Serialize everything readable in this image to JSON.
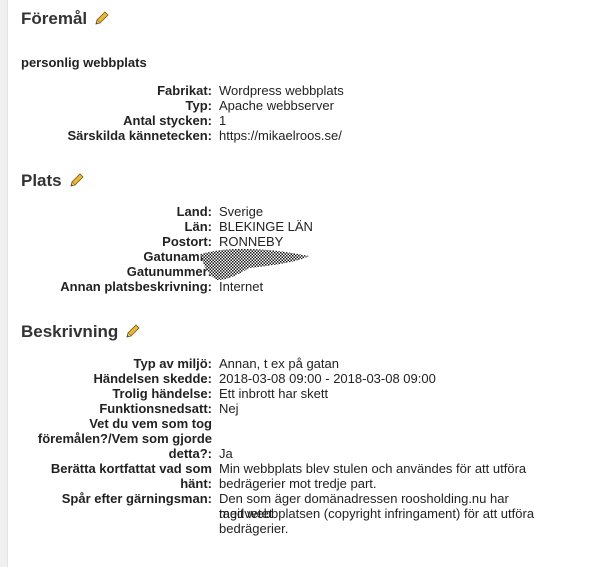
{
  "foremal": {
    "title": "Föremål",
    "edit_icon": "pencil-icon",
    "subtitle": "personlig webbplats",
    "rows": [
      {
        "label": "Fabrikat:",
        "value": "Wordpress webbplats"
      },
      {
        "label": "Typ:",
        "value": "Apache webbserver"
      },
      {
        "label": "Antal stycken:",
        "value": "1"
      },
      {
        "label": "Särskilda kännetecken:",
        "value": "https://mikaelroos.se/"
      }
    ]
  },
  "plats": {
    "title": "Plats",
    "edit_icon": "pencil-icon",
    "rows": [
      {
        "label": "Land:",
        "value": "Sverige"
      },
      {
        "label": "Län:",
        "value": "BLEKINGE LÄN"
      },
      {
        "label": "Postort:",
        "value": "RONNEBY"
      },
      {
        "label": "Gatunamn:",
        "value": ""
      },
      {
        "label": "Gatunummer:",
        "value": ""
      },
      {
        "label": "Annan platsbeskrivning:",
        "value": "Internet"
      }
    ]
  },
  "beskrivning": {
    "title": "Beskrivning",
    "edit_icon": "pencil-icon",
    "rows": [
      {
        "label": "Typ av miljö:",
        "value": "Annan, t ex på gatan"
      },
      {
        "label": "Händelsen skedde:",
        "value": "2018-03-08 09:00 - 2018-03-08 09:00"
      },
      {
        "label": "Trolig händelse:",
        "value": "Ett inbrott har skett"
      },
      {
        "label": "Funktionsnedsatt:",
        "value": "Nej"
      },
      {
        "label_lines": [
          "Vet du vem som tog",
          "föremålen?/Vem som gjorde",
          "detta?:"
        ],
        "value": "Ja"
      },
      {
        "label_lines": [
          "Berätta kortfattat vad som",
          "hänt:"
        ],
        "value_lines": [
          "Min webbplats blev stulen och användes för att utföra",
          "bedrägerier mot tredje part."
        ]
      },
      {
        "label": "Spår efter gärningsman:",
        "value_lines": [
          "Den som äger domänadressen roosholding.nu har medvetet",
          "tagit webbplatsen (copyright infringament) för att utföra",
          "bedrägerier."
        ]
      }
    ]
  },
  "colors": {
    "pencil_body": "#e8b83a",
    "pencil_tip": "#444444",
    "heading": "#333333"
  }
}
